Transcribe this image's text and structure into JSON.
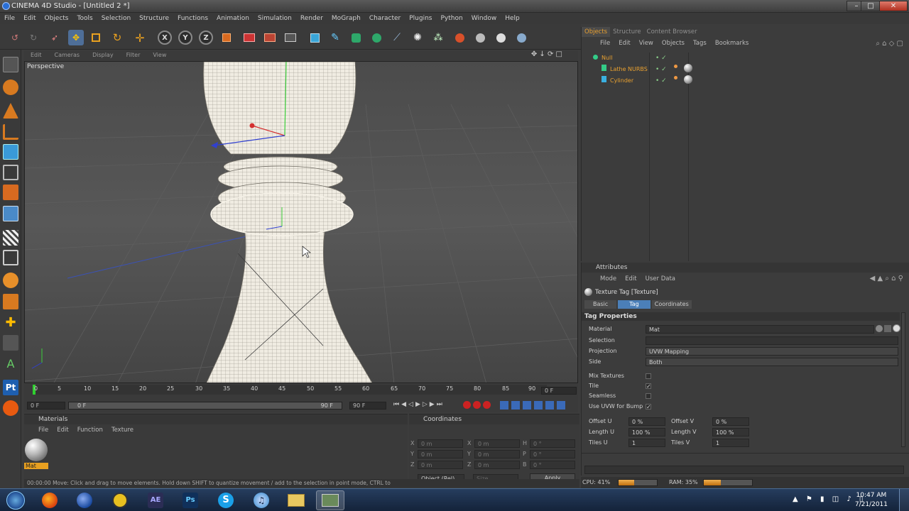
{
  "window": {
    "title": "CINEMA 4D Studio - [Untitled 2 *]"
  },
  "menu": [
    "File",
    "Edit",
    "Objects",
    "Tools",
    "Selection",
    "Structure",
    "Functions",
    "Animation",
    "Simulation",
    "Render",
    "MoGraph",
    "Character",
    "Plugins",
    "Python",
    "Window",
    "Help"
  ],
  "toolbar": {
    "axes": [
      "X",
      "Y",
      "Z"
    ]
  },
  "viewport": {
    "menu": [
      "Edit",
      "Cameras",
      "Display",
      "Filter",
      "View"
    ],
    "label": "Perspective"
  },
  "timeline": {
    "ticks": [
      "0",
      "5",
      "10",
      "15",
      "20",
      "25",
      "30",
      "35",
      "40",
      "45",
      "50",
      "55",
      "60",
      "65",
      "70",
      "75",
      "80",
      "85",
      "90"
    ],
    "current_frame": "0 F",
    "start_field": "0 F",
    "range_start": "0 F",
    "range_end": "90 F",
    "end_field": "90 F"
  },
  "materials": {
    "title": "Materials",
    "menu": [
      "File",
      "Edit",
      "Function",
      "Texture"
    ],
    "items": [
      {
        "name": "Mat"
      }
    ]
  },
  "coordinates": {
    "title": "Coordinates",
    "rows": [
      {
        "a": "X",
        "av": "0 m",
        "b": "X",
        "bv": "0 m",
        "c": "H",
        "cv": "0 °"
      },
      {
        "a": "Y",
        "av": "0 m",
        "b": "Y",
        "bv": "0 m",
        "c": "P",
        "cv": "0 °"
      },
      {
        "a": "Z",
        "av": "0 m",
        "b": "Z",
        "bv": "0 m",
        "c": "B",
        "cv": "0 °"
      }
    ],
    "mode": "Object (Rel)",
    "size_mode": "Size",
    "apply": "Apply"
  },
  "status": {
    "text": "00:00:00  Move: Click and drag to move elements. Hold down SHIFT to quantize movement / add to the selection in point mode, CTRL to"
  },
  "object_manager": {
    "tabs": [
      "Objects",
      "Structure",
      "Content Browser"
    ],
    "menu": [
      "File",
      "Edit",
      "View",
      "Objects",
      "Tags",
      "Bookmarks"
    ],
    "objects": [
      {
        "name": "Null",
        "level": 0
      },
      {
        "name": "Lathe NURBS",
        "level": 1
      },
      {
        "name": "Cylinder",
        "level": 1
      }
    ]
  },
  "attributes": {
    "title": "Attributes",
    "menu": [
      "Mode",
      "Edit",
      "User Data"
    ],
    "header": "Texture Tag [Texture]",
    "tabs": [
      "Basic",
      "Tag",
      "Coordinates"
    ],
    "active_tab": "Tag",
    "section": "Tag Properties",
    "fields": {
      "material_label": "Material",
      "material_value": "Mat",
      "selection_label": "Selection",
      "selection_value": "",
      "projection_label": "Projection",
      "projection_value": "UVW Mapping",
      "side_label": "Side",
      "side_value": "Both",
      "mix_label": "Mix Textures",
      "tile_label": "Tile",
      "seamless_label": "Seamless",
      "uvw_bump_label": "Use UVW for Bump",
      "offset_u_label": "Offset U",
      "offset_u": "0 %",
      "offset_v_label": "Offset V",
      "offset_v": "0 %",
      "length_u_label": "Length U",
      "length_u": "100 %",
      "length_v_label": "Length V",
      "length_v": "100 %",
      "tiles_u_label": "Tiles U",
      "tiles_u": "1",
      "tiles_v_label": "Tiles V",
      "tiles_v": "1"
    }
  },
  "resources": {
    "cpu": "CPU: 41%",
    "cpu_fraction": 0.41,
    "ram": "RAM: 35%",
    "ram_fraction": 0.35
  },
  "taskbar": {
    "apps": [
      "windows-start",
      "firefox",
      "cinema4d",
      "norton",
      "after-effects",
      "photoshop",
      "skype",
      "itunes",
      "folder",
      "cinema4d-active"
    ],
    "time": "10:47 AM",
    "date": "7/21/2011"
  }
}
